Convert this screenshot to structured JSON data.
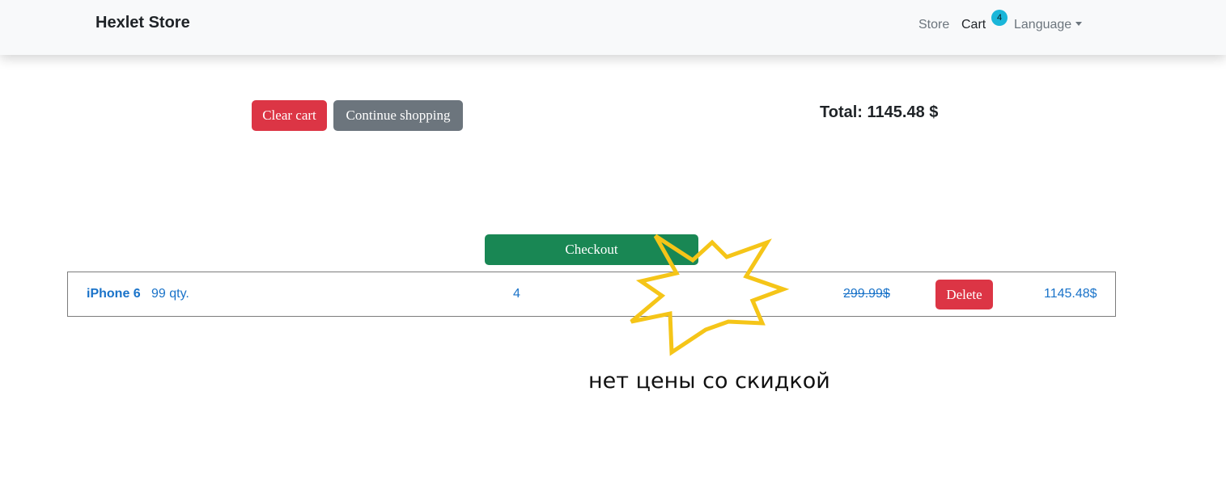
{
  "navbar": {
    "brand": "Hexlet Store",
    "store_link": "Store",
    "cart_link": "Cart",
    "cart_badge": "4",
    "language_link": "Language"
  },
  "cart": {
    "clear_label": "Clear cart",
    "continue_label": "Continue shopping",
    "total": "Total: 1145.48 $",
    "checkout_label": "Checkout"
  },
  "item": {
    "name": "iPhone 6",
    "stock": "99 qty.",
    "quantity": "4",
    "price": "299.99$",
    "delete_label": "Delete",
    "line_total": "1145.48$"
  },
  "annotation": {
    "note": "нет цены со скидкой",
    "star_color": "#f5c518"
  },
  "colors": {
    "danger": "#dc3545",
    "secondary": "#6c757d",
    "success": "#198754",
    "link": "#1a73c9",
    "badge": "#1ab6d9"
  }
}
